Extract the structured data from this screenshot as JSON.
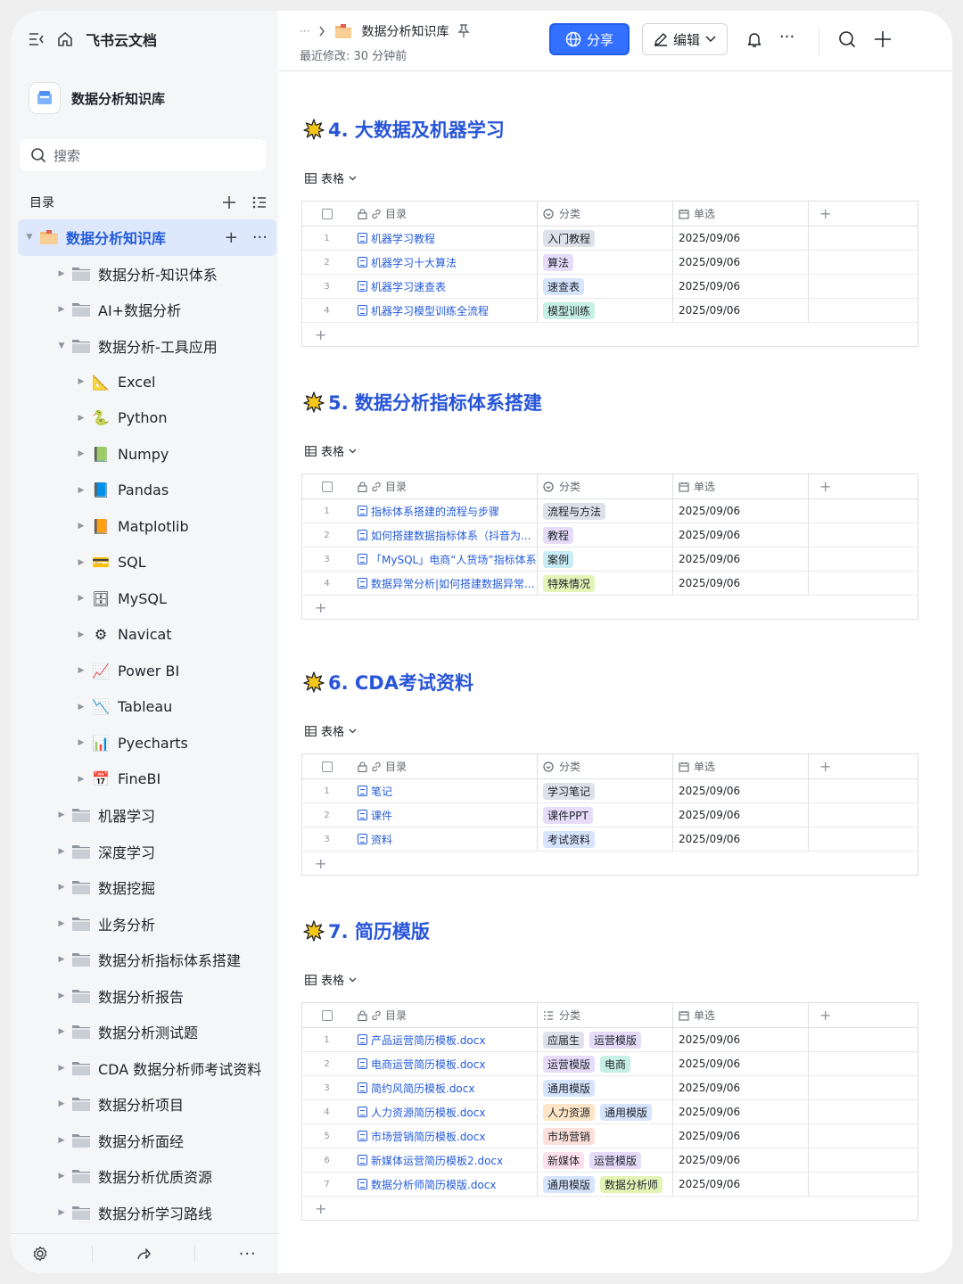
{
  "app": {
    "title": "飞书云文档"
  },
  "space": {
    "name": "数据分析知识库"
  },
  "search": {
    "placeholder": "搜索"
  },
  "toc": {
    "label": "目录"
  },
  "tree": [
    {
      "label": "数据分析知识库",
      "level": 0,
      "icon": "folder-color",
      "active": true,
      "open": true
    },
    {
      "label": "数据分析-知识体系",
      "level": 1,
      "icon": "folder"
    },
    {
      "label": "AI+数据分析",
      "level": 1,
      "icon": "folder"
    },
    {
      "label": "数据分析-工具应用",
      "level": 1,
      "icon": "folder",
      "open": true
    },
    {
      "label": "Excel",
      "level": 2,
      "icon": "📐"
    },
    {
      "label": "Python",
      "level": 2,
      "icon": "🐍"
    },
    {
      "label": "Numpy",
      "level": 2,
      "icon": "📗"
    },
    {
      "label": "Pandas",
      "level": 2,
      "icon": "📘"
    },
    {
      "label": "Matplotlib",
      "level": 2,
      "icon": "📙"
    },
    {
      "label": "SQL",
      "level": 2,
      "icon": "💳"
    },
    {
      "label": "MySQL",
      "level": 2,
      "icon": "🗄"
    },
    {
      "label": "Navicat",
      "level": 2,
      "icon": "⚙"
    },
    {
      "label": "Power BI",
      "level": 2,
      "icon": "📈"
    },
    {
      "label": "Tableau",
      "level": 2,
      "icon": "📉"
    },
    {
      "label": "Pyecharts",
      "level": 2,
      "icon": "📊"
    },
    {
      "label": "FineBI",
      "level": 2,
      "icon": "📅"
    },
    {
      "label": "机器学习",
      "level": 1,
      "icon": "folder"
    },
    {
      "label": "深度学习",
      "level": 1,
      "icon": "folder"
    },
    {
      "label": "数据挖掘",
      "level": 1,
      "icon": "folder"
    },
    {
      "label": "业务分析",
      "level": 1,
      "icon": "folder"
    },
    {
      "label": "数据分析指标体系搭建",
      "level": 1,
      "icon": "folder"
    },
    {
      "label": "数据分析报告",
      "level": 1,
      "icon": "folder"
    },
    {
      "label": "数据分析测试题",
      "level": 1,
      "icon": "folder"
    },
    {
      "label": "CDA 数据分析师考试资料",
      "level": 1,
      "icon": "folder"
    },
    {
      "label": "数据分析项目",
      "level": 1,
      "icon": "folder"
    },
    {
      "label": "数据分析面经",
      "level": 1,
      "icon": "folder"
    },
    {
      "label": "数据分析优质资源",
      "level": 1,
      "icon": "folder"
    },
    {
      "label": "数据分析学习路线",
      "level": 1,
      "icon": "folder"
    }
  ],
  "topbar": {
    "ellipsis": "···",
    "crumb": "数据分析知识库",
    "modified": "最近修改: 30 分钟前",
    "share": "分享",
    "edit": "编辑"
  },
  "columns": {
    "dir": "目录",
    "cat": "分类",
    "single": "单选"
  },
  "view_label": "表格",
  "sections": [
    {
      "title": "4. 大数据及机器学习",
      "rows": [
        {
          "n": "1",
          "name": "机器学习教程",
          "tags": [
            {
              "t": "入门教程",
              "c": "#dde1ea"
            }
          ],
          "date": "2025/09/06"
        },
        {
          "n": "2",
          "name": "机器学习十大算法",
          "tags": [
            {
              "t": "算法",
              "c": "#e6dcfa"
            }
          ],
          "date": "2025/09/06"
        },
        {
          "n": "3",
          "name": "机器学习速查表",
          "tags": [
            {
              "t": "速查表",
              "c": "#d6e4fd"
            }
          ],
          "date": "2025/09/06"
        },
        {
          "n": "4",
          "name": "机器学习模型训练全流程",
          "tags": [
            {
              "t": "模型训练",
              "c": "#c7f0e4"
            }
          ],
          "date": "2025/09/06"
        }
      ]
    },
    {
      "title": "5. 数据分析指标体系搭建",
      "rows": [
        {
          "n": "1",
          "name": "指标体系搭建的流程与步骤",
          "tags": [
            {
              "t": "流程与方法",
              "c": "#dde1ea"
            }
          ],
          "date": "2025/09/06"
        },
        {
          "n": "2",
          "name": "如何搭建数据指标体系（抖音为...",
          "tags": [
            {
              "t": "教程",
              "c": "#e6dcfa"
            }
          ],
          "date": "2025/09/06"
        },
        {
          "n": "3",
          "name": "「MySQL」电商“人货场”指标体系...",
          "tags": [
            {
              "t": "案例",
              "c": "#c9ecf5"
            }
          ],
          "date": "2025/09/06"
        },
        {
          "n": "4",
          "name": "数据异常分析|如何搭建数据异常...",
          "tags": [
            {
              "t": "特殊情况",
              "c": "#e2f4b6"
            }
          ],
          "date": "2025/09/06"
        }
      ]
    },
    {
      "title": "6. CDA考试资料",
      "rows": [
        {
          "n": "1",
          "name": "笔记",
          "tags": [
            {
              "t": "学习笔记",
              "c": "#dde1ea"
            }
          ],
          "date": "2025/09/06"
        },
        {
          "n": "2",
          "name": "课件",
          "tags": [
            {
              "t": "课件PPT",
              "c": "#e6dcfa"
            }
          ],
          "date": "2025/09/06"
        },
        {
          "n": "3",
          "name": "资料",
          "tags": [
            {
              "t": "考试资料",
              "c": "#d6e4fd"
            }
          ],
          "date": "2025/09/06"
        }
      ]
    },
    {
      "title": "7. 简历模版",
      "rows": [
        {
          "n": "1",
          "name": "产品运营简历模板.docx",
          "tags": [
            {
              "t": "应届生",
              "c": "#dde1ea"
            },
            {
              "t": "运营模版",
              "c": "#e6dcfa"
            }
          ],
          "date": "2025/09/06"
        },
        {
          "n": "2",
          "name": "电商运营简历模板.docx",
          "tags": [
            {
              "t": "运营模版",
              "c": "#e6dcfa"
            },
            {
              "t": "电商",
              "c": "#c7f0e4"
            }
          ],
          "date": "2025/09/06"
        },
        {
          "n": "3",
          "name": "简约风简历模板.docx",
          "tags": [
            {
              "t": "通用模版",
              "c": "#d6e4fd"
            }
          ],
          "date": "2025/09/06"
        },
        {
          "n": "4",
          "name": "人力资源简历模板.docx",
          "tags": [
            {
              "t": "人力资源",
              "c": "#fde5c5"
            },
            {
              "t": "通用模版",
              "c": "#d6e4fd"
            }
          ],
          "date": "2025/09/06"
        },
        {
          "n": "5",
          "name": "市场营销简历模板.docx",
          "tags": [
            {
              "t": "市场营销",
              "c": "#fde0d9"
            }
          ],
          "date": "2025/09/06"
        },
        {
          "n": "6",
          "name": "新媒体运营简历模板2.docx",
          "tags": [
            {
              "t": "新媒体",
              "c": "#fde0e9"
            },
            {
              "t": "运营模版",
              "c": "#e6dcfa"
            }
          ],
          "date": "2025/09/06"
        },
        {
          "n": "7",
          "name": "数据分析师简历模版.docx",
          "tags": [
            {
              "t": "通用模版",
              "c": "#d6e4fd"
            },
            {
              "t": "数据分析师",
              "c": "#e2f4b6"
            }
          ],
          "date": "2025/09/06"
        }
      ]
    }
  ]
}
